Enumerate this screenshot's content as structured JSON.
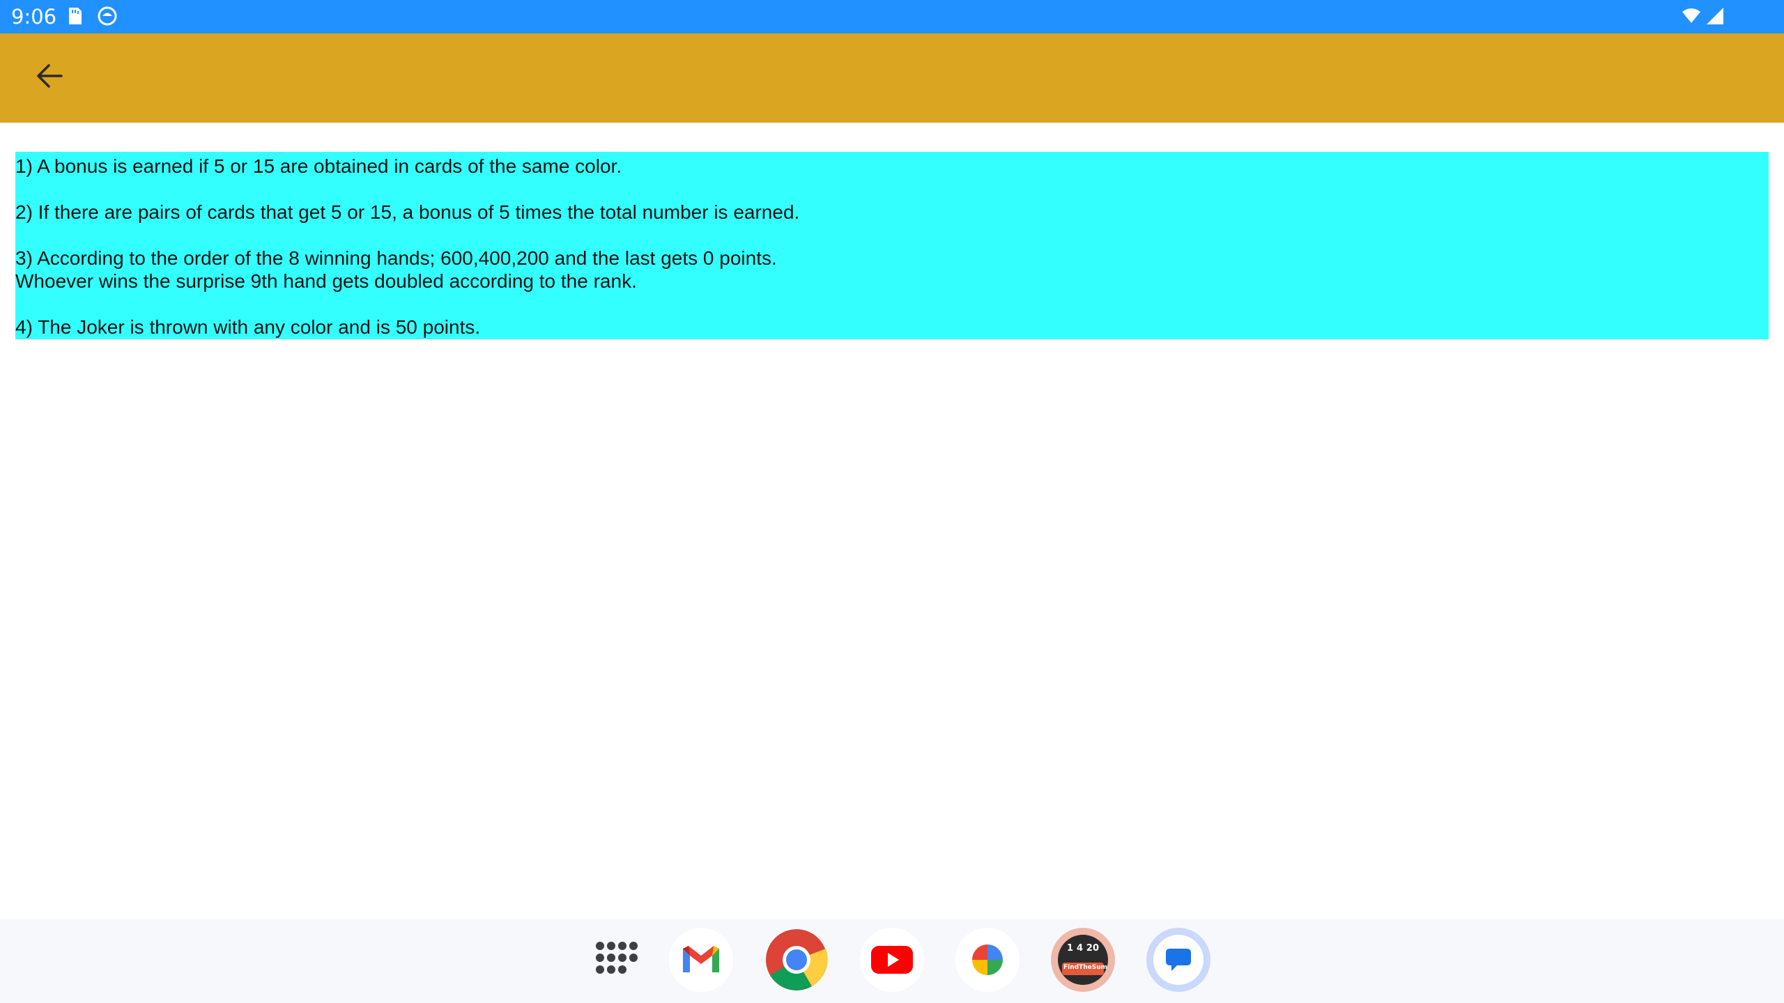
{
  "status_bar": {
    "time": "9:06",
    "icons": [
      "sd-card-icon",
      "app-notification-icon",
      "wifi-icon",
      "signal-icon"
    ],
    "color": "#2191ff"
  },
  "app_bar": {
    "color": "#daa520",
    "back_icon": "arrow-back-icon"
  },
  "rules": {
    "background": "#33ffff",
    "lines": [
      "1) A bonus is earned if 5 or 15 are obtained in cards of the same color.",
      "2) If there are pairs of cards that get 5 or 15, a bonus of 5 times the total number is earned.",
      "3) According to the order of the 8 winning hands; 600,400,200 and the last gets 0 points.",
      "Whoever wins the surprise 9th hand gets doubled according to the rank.",
      "4) The Joker is thrown with any color and is 50 points."
    ]
  },
  "dock": {
    "apps": [
      "app-drawer-icon",
      "gmail-icon",
      "chrome-icon",
      "youtube-icon",
      "photos-icon",
      "findthesum-game-icon",
      "messages-icon"
    ],
    "game_icon_text": {
      "numbers": [
        "1",
        "4",
        "20"
      ],
      "label": "FindTheSum"
    }
  }
}
